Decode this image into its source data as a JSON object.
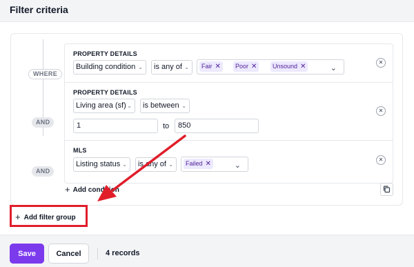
{
  "header": {
    "title": "Filter criteria"
  },
  "connectors": {
    "where": "WHERE",
    "and": "AND"
  },
  "conditions": [
    {
      "title": "PROPERTY DETAILS",
      "field": "Building condition",
      "operator": "is any of",
      "tags": [
        "Fair",
        "Poor",
        "Unsound"
      ]
    },
    {
      "title": "PROPERTY DETAILS",
      "field": "Living area (sf)",
      "operator": "is between",
      "min": "1",
      "to_label": "to",
      "max": "850"
    },
    {
      "title": "MLS",
      "field": "Listing status",
      "operator": "is any of",
      "tags": [
        "Failed"
      ]
    }
  ],
  "actions": {
    "add_condition": "Add condition",
    "add_filter_group": "Add filter group"
  },
  "footer": {
    "save": "Save",
    "cancel": "Cancel",
    "records": "4 records"
  },
  "icons": {
    "plus": "+",
    "remove": "✕",
    "tag_remove": "✕",
    "chevron": "⌄"
  },
  "colors": {
    "accent": "#7c3aed",
    "tag_bg": "#ede9fe",
    "annotation_red": "#e11d2a"
  }
}
